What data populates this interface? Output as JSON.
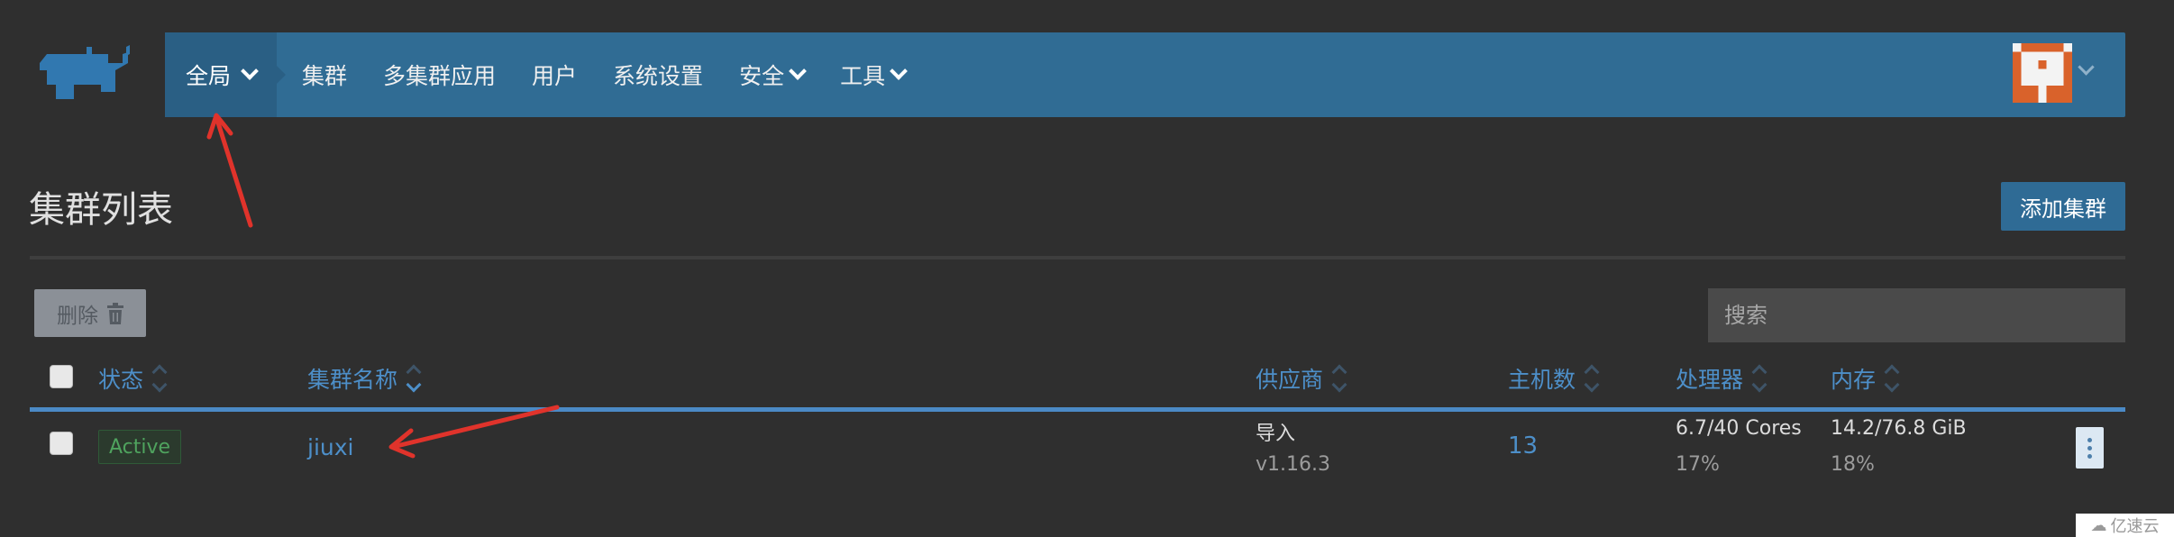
{
  "nav": {
    "scope_label": "全局",
    "items": [
      {
        "label": "集群",
        "has_dropdown": false
      },
      {
        "label": "多集群应用",
        "has_dropdown": false
      },
      {
        "label": "用户",
        "has_dropdown": false
      },
      {
        "label": "系统设置",
        "has_dropdown": false
      },
      {
        "label": "安全",
        "has_dropdown": true
      },
      {
        "label": "工具",
        "has_dropdown": true
      }
    ],
    "logo_icon": "rancher-logo-icon",
    "avatar_icon": "identicon-avatar",
    "brand_color": "#306c94"
  },
  "page": {
    "title": "集群列表",
    "add_button": "添加集群",
    "delete_button": "删除",
    "search_placeholder": "搜索"
  },
  "table": {
    "columns": [
      "状态",
      "集群名称",
      "供应商",
      "主机数",
      "处理器",
      "内存"
    ],
    "rows": [
      {
        "status": "Active",
        "name": "jiuxi",
        "provider": "导入",
        "version": "v1.16.3",
        "nodes": "13",
        "cpu": "6.7/40 Cores",
        "cpu_pct": "17%",
        "memory": "14.2/76.8 GiB",
        "memory_pct": "18%"
      }
    ]
  },
  "watermark": "亿速云",
  "colors": {
    "accent": "#4d8fc9",
    "active_status": "#4fa35e",
    "annotation_arrow": "#e0332b"
  }
}
